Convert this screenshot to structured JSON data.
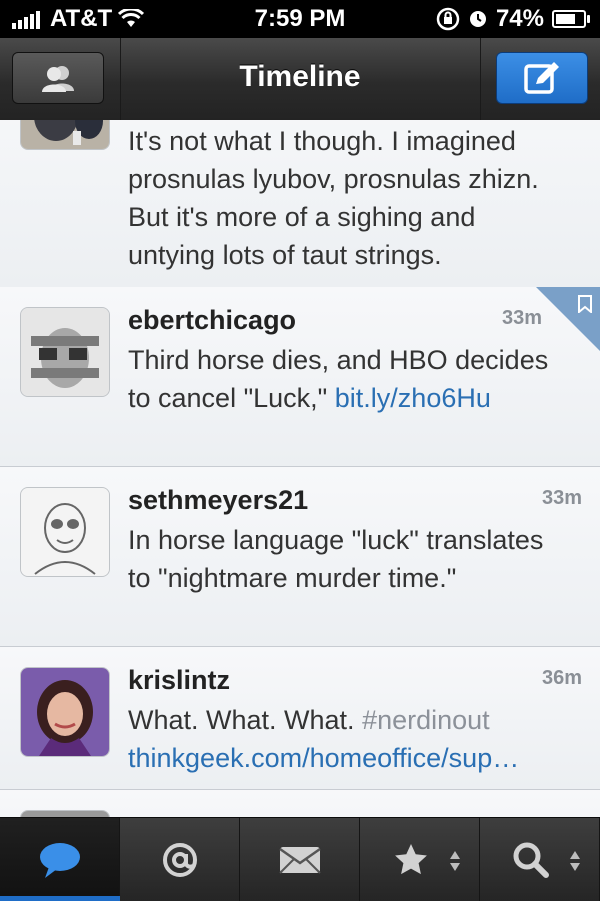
{
  "status": {
    "carrier": "AT&T",
    "time": "7:59 PM",
    "battery": "74%",
    "battery_level": 0.74
  },
  "nav": {
    "title": "Timeline",
    "left_icon": "accounts-icon",
    "right_icon": "compose-icon"
  },
  "tweets": [
    {
      "username": "",
      "time": "",
      "text": "It's not what I though. I imagined prosnulas lyubov, prosnulas zhizn. But it's more of a sighing and untying lots of taut strings."
    },
    {
      "username": "ebertchicago",
      "time": "33m",
      "text_before": "Third horse dies, and HBO decides to cancel \"Luck,\" ",
      "link": "bit.ly/zho6Hu",
      "bookmarked": true
    },
    {
      "username": "sethmeyers21",
      "time": "33m",
      "text": "In horse language \"luck\" translates to \"nightmare murder time.\""
    },
    {
      "username": "krislintz",
      "time": "36m",
      "text_before": "What. What. What. ",
      "hashtag": "#nerdinout",
      "link": "thinkgeek.com/homeoffice/sup…"
    },
    {
      "username": "",
      "time": ""
    }
  ],
  "tabs": [
    {
      "name": "timeline",
      "icon": "speech-bubble-icon",
      "active": true
    },
    {
      "name": "mentions",
      "icon": "at-icon",
      "active": false
    },
    {
      "name": "messages",
      "icon": "envelope-icon",
      "active": false
    },
    {
      "name": "favorites",
      "icon": "star-icon",
      "active": false
    },
    {
      "name": "search",
      "icon": "search-icon",
      "active": false
    }
  ],
  "colors": {
    "accent": "#1f6dc7",
    "link": "#2a6fb3",
    "navbar": "#2b2b2b"
  }
}
